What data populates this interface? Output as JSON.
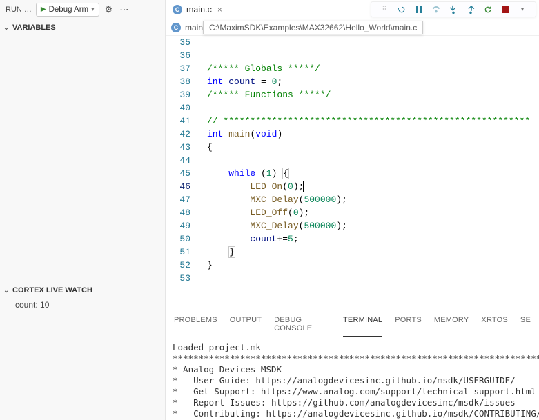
{
  "sidebar": {
    "run_label": "RUN …",
    "debug_config": "Debug Arm",
    "sections": {
      "variables": "VARIABLES",
      "cortex": "CORTEX LIVE WATCH"
    },
    "watch_item": "count: 10"
  },
  "tab": {
    "file": "main.c",
    "breadcrumb_file": "main.c",
    "tooltip_path": "C:\\MaximSDK\\Examples\\MAX32662\\Hello_World\\main.c"
  },
  "code": {
    "lines": [
      {
        "n": 35,
        "html": ""
      },
      {
        "n": 36,
        "html": ""
      },
      {
        "n": 37,
        "html": "<span class=\"tok-cmt\">/***** Globals *****/</span>"
      },
      {
        "n": 38,
        "html": "<span class=\"tok-kw\">int</span> <span class=\"tok-ident\">count</span> = <span class=\"tok-num\">0</span>;"
      },
      {
        "n": 39,
        "html": "<span class=\"tok-cmt\">/***** Functions *****/</span>"
      },
      {
        "n": 40,
        "html": ""
      },
      {
        "n": 41,
        "html": "<span class=\"tok-cmt\">// *********************************************************</span>"
      },
      {
        "n": 42,
        "html": "<span class=\"tok-kw\">int</span> <span class=\"tok-fn\">main</span>(<span class=\"tok-kw\">void</span>)"
      },
      {
        "n": 43,
        "html": "{"
      },
      {
        "n": 44,
        "html": ""
      },
      {
        "n": 45,
        "html": "    <span class=\"tok-kw\">while</span> (<span class=\"tok-num\">1</span>) <span class=\"dim-brace\">{</span>"
      },
      {
        "n": 46,
        "html": "        <span class=\"tok-fn\">LED_On</span>(<span class=\"tok-num\">0</span>);<span class=\"cursor\"></span>",
        "current": true
      },
      {
        "n": 47,
        "html": "        <span class=\"tok-fn\">MXC_Delay</span>(<span class=\"tok-num\">500000</span>);"
      },
      {
        "n": 48,
        "html": "        <span class=\"tok-fn\">LED_Off</span>(<span class=\"tok-num\">0</span>);"
      },
      {
        "n": 49,
        "html": "        <span class=\"tok-fn\">MXC_Delay</span>(<span class=\"tok-num\">500000</span>);"
      },
      {
        "n": 50,
        "html": "        <span class=\"tok-ident\">count</span>+=<span class=\"tok-num\">5</span>;"
      },
      {
        "n": 51,
        "html": "    <span class=\"dim-brace\">}</span>"
      },
      {
        "n": 52,
        "html": "}"
      },
      {
        "n": 53,
        "html": ""
      }
    ]
  },
  "panel": {
    "tabs": [
      "PROBLEMS",
      "OUTPUT",
      "DEBUG CONSOLE",
      "TERMINAL",
      "PORTS",
      "MEMORY",
      "XRTOS",
      "SE"
    ],
    "active": "TERMINAL",
    "terminal_lines": [
      "Loaded project.mk",
      "*************************************************************************",
      "* Analog Devices MSDK",
      "* - User Guide: https://analogdevicesinc.github.io/msdk/USERGUIDE/",
      "* - Get Support: https://www.analog.com/support/technical-support.html",
      "* - Report Issues: https://github.com/analogdevicesinc/msdk/issues",
      "* - Contributing: https://analogdevicesinc.github.io/msdk/CONTRIBUTING/"
    ]
  }
}
